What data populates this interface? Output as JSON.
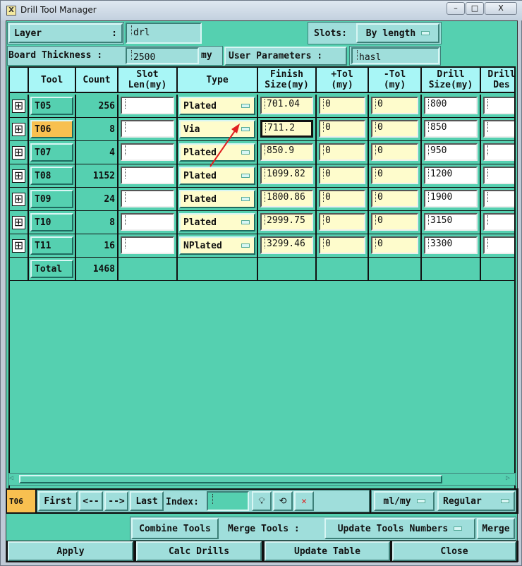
{
  "window": {
    "title": "Drill Tool Manager",
    "minimize": "▭",
    "maximize": "▫",
    "close": "X"
  },
  "top": {
    "layer_label": "Layer",
    "layer_colon": ":",
    "layer_value": "drl",
    "slots_label": "Slots:",
    "slots_value": "By length",
    "board_thickness_label": "Board Thickness :",
    "board_thickness_value": "2500",
    "board_thickness_unit": "my",
    "user_params_label": "User Parameters :",
    "user_params_value": "hasl"
  },
  "table": {
    "headers": [
      "",
      "Tool",
      "Count",
      "Slot\nLen(my)",
      "Type",
      "Finish\nSize(my)",
      "+Tol\n(my)",
      "-Tol\n(my)",
      "Drill\nSize(my)",
      "Drill\nDes"
    ],
    "rows": [
      {
        "tool": "T05",
        "count": "256",
        "slot": "",
        "type": "Plated",
        "finish": "701.04",
        "ptol": "0",
        "mtol": "0",
        "drill": "800",
        "des": ""
      },
      {
        "tool": "T06",
        "count": "8",
        "slot": "",
        "type": "Via",
        "finish": "711.2",
        "ptol": "0",
        "mtol": "0",
        "drill": "850",
        "des": "",
        "selected": true
      },
      {
        "tool": "T07",
        "count": "4",
        "slot": "",
        "type": "Plated",
        "finish": "850.9",
        "ptol": "0",
        "mtol": "0",
        "drill": "950",
        "des": ""
      },
      {
        "tool": "T08",
        "count": "1152",
        "slot": "",
        "type": "Plated",
        "finish": "1099.82",
        "ptol": "0",
        "mtol": "0",
        "drill": "1200",
        "des": ""
      },
      {
        "tool": "T09",
        "count": "24",
        "slot": "",
        "type": "Plated",
        "finish": "1800.86",
        "ptol": "0",
        "mtol": "0",
        "drill": "1900",
        "des": ""
      },
      {
        "tool": "T10",
        "count": "8",
        "slot": "",
        "type": "Plated",
        "finish": "2999.75",
        "ptol": "0",
        "mtol": "0",
        "drill": "3150",
        "des": ""
      },
      {
        "tool": "T11",
        "count": "16",
        "slot": "",
        "type": "NPlated",
        "finish": "3299.46",
        "ptol": "0",
        "mtol": "0",
        "drill": "3300",
        "des": ""
      }
    ],
    "total_label": "Total",
    "total_count": "1468"
  },
  "nav": {
    "current_tool": "T06",
    "first": "First",
    "prev": "<--",
    "next": "-->",
    "last": "Last",
    "index_label": "Index:",
    "index_value": "",
    "units": "ml/my",
    "mode": "Regular"
  },
  "merge": {
    "combine": "Combine Tools",
    "merge_label": "Merge Tools :",
    "merge_option": "Update Tools Numbers",
    "merge_button": "Merge"
  },
  "actions": {
    "apply": "Apply",
    "calc": "Calc Drills",
    "update": "Update Table",
    "close": "Close"
  },
  "colors": {
    "background": "#55d0b0",
    "selected_tool": "#f8c050",
    "input_yellow": "#fefccc",
    "arrow": "#e02020"
  }
}
